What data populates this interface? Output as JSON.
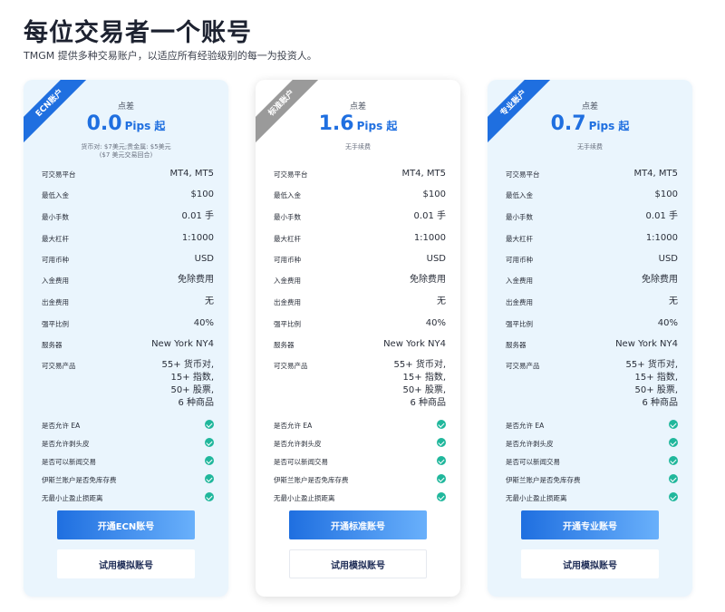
{
  "page": {
    "title": "每位交易者一个账号",
    "subtitle": "TMGM 提供多种交易账户，以适应所有经验级别的每一为投资人。"
  },
  "labels": {
    "spread": "点差",
    "platforms": "可交易平台",
    "min_deposit": "最低入金",
    "min_lot": "最小手数",
    "max_leverage": "最大杠杆",
    "currency": "可用币种",
    "deposit_fee": "入金费用",
    "withdrawal_fee": "出金费用",
    "stop_out": "强平比例",
    "server": "服务器",
    "products": "可交易产品",
    "ea": "是否允许 EA",
    "scalping": "是否允许剥头皮",
    "news": "是否可以新闻交易",
    "islamic": "伊斯兰账户是否免库存费",
    "no_min_stop": "无最小止盈止损距离"
  },
  "accounts": [
    {
      "ribbon": "ECN账户",
      "spread": "0.0",
      "unit": "Pips 起",
      "commission_1": "货币对: $7美元;贵金属: $5美元",
      "commission_2": "($7 美元交易回合)",
      "platforms": "MT4, MT5",
      "min_deposit": "$100",
      "min_lot": "0.01 手",
      "max_leverage": "1:1000",
      "currency": "USD",
      "deposit_fee": "免除费用",
      "withdrawal_fee": "无",
      "stop_out": "40%",
      "server": "New York NY4",
      "products": [
        "55+ 货币对,",
        "15+ 指数,",
        "50+ 股票,",
        "6 种商品"
      ],
      "open_button": "开通ECN账号",
      "demo_button": "试用模拟账号"
    },
    {
      "ribbon": "标准账户",
      "spread": "1.6",
      "unit": "Pips 起",
      "commission_1": "无手续费",
      "commission_2": "",
      "platforms": "MT4, MT5",
      "min_deposit": "$100",
      "min_lot": "0.01 手",
      "max_leverage": "1:1000",
      "currency": "USD",
      "deposit_fee": "免除费用",
      "withdrawal_fee": "无",
      "stop_out": "40%",
      "server": "New York NY4",
      "products": [
        "55+ 货币对,",
        "15+ 指数,",
        "50+ 股票,",
        "6 种商品"
      ],
      "open_button": "开通标准账号",
      "demo_button": "试用模拟账号"
    },
    {
      "ribbon": "专业账户",
      "spread": "0.7",
      "unit": "Pips 起",
      "commission_1": "无手续费",
      "commission_2": "",
      "platforms": "MT4, MT5",
      "min_deposit": "$100",
      "min_lot": "0.01 手",
      "max_leverage": "1:1000",
      "currency": "USD",
      "deposit_fee": "免除费用",
      "withdrawal_fee": "无",
      "stop_out": "40%",
      "server": "New York NY4",
      "products": [
        "55+ 货币对,",
        "15+ 指数,",
        "50+ 股票,",
        "6 种商品"
      ],
      "open_button": "开通专业账号",
      "demo_button": "试用模拟账号"
    }
  ],
  "icons": {
    "check": "check-circle-icon"
  },
  "colors": {
    "accent": "#1f6fe0",
    "check": "#20b79c",
    "ribbon_standard": "#9a9a9a"
  }
}
